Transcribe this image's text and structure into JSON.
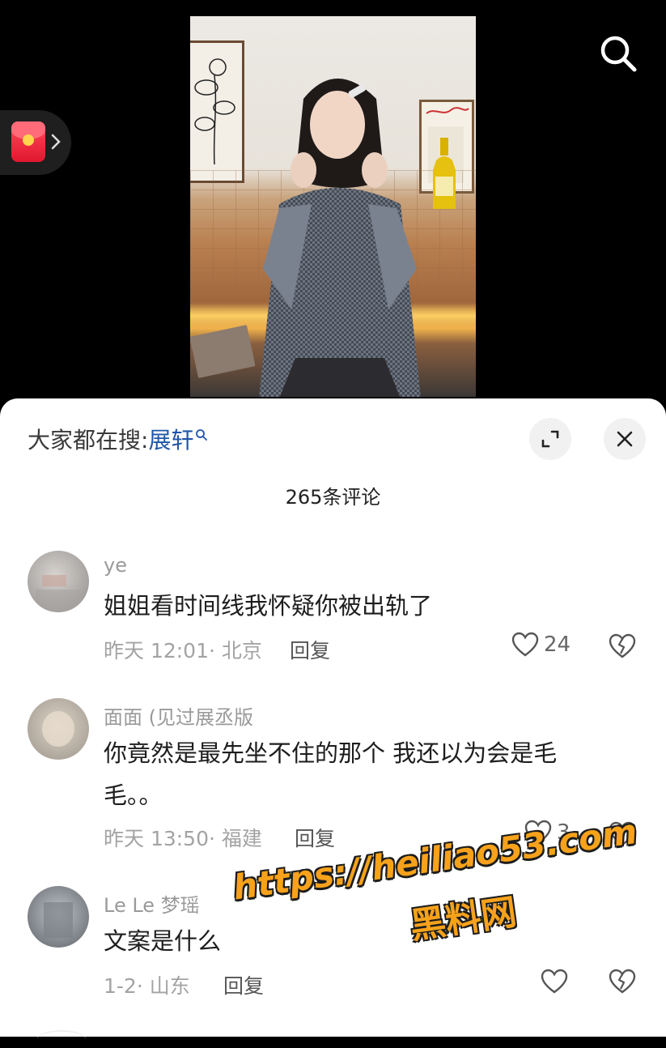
{
  "video": {
    "icons": {
      "search": "search-icon",
      "red_packet": "red-packet-icon"
    }
  },
  "sheet": {
    "hot_search_prefix": "大家都在搜:",
    "hot_search_keyword": "展轩",
    "comment_count": "265条评论",
    "icons": {
      "expand": "expand-icon",
      "close": "close-icon",
      "search_small": "search-icon"
    }
  },
  "comments": [
    {
      "username": "ye",
      "text": "姐姐看时间线我怀疑你被出轨了",
      "meta": "昨天 12:01· 北京",
      "reply_label": "回复",
      "likes": "24"
    },
    {
      "username": "面面 (见过展丞版",
      "text": "你竟然是最先坐不住的那个 我还以为会是毛毛。。",
      "meta": "昨天 13:50· 福建",
      "reply_label": "回复",
      "likes": "3"
    },
    {
      "username": "Le Le 梦瑶",
      "text": "文案是什么",
      "meta": "1-2· 山东",
      "reply_label": "回复",
      "likes": ""
    }
  ],
  "watermark": {
    "url": "https://heiliao53.com",
    "name": "黑料网"
  },
  "colors": {
    "keyword": "#1f56a8",
    "watermark": "#f7a21b",
    "sheet_bg": "#ffffff",
    "video_bg": "#000000"
  }
}
